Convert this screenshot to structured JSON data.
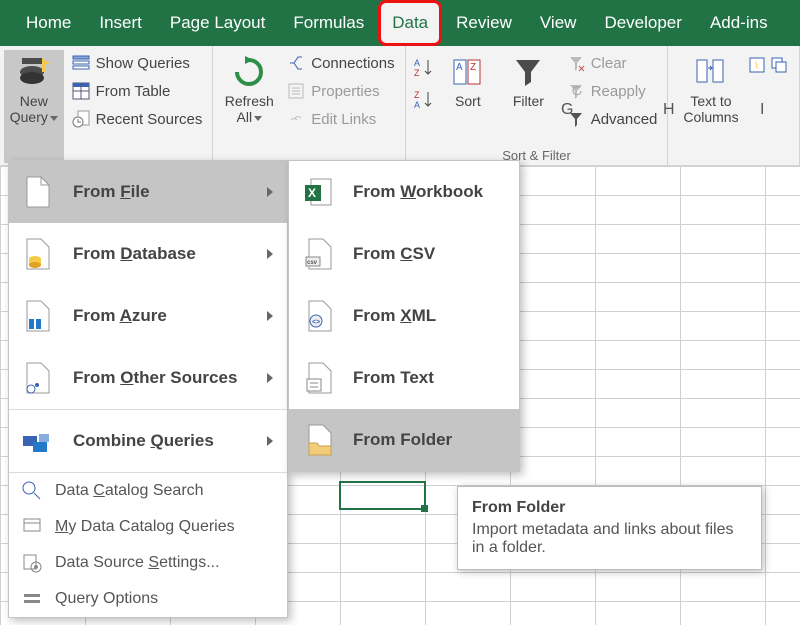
{
  "tabs": [
    "Home",
    "Insert",
    "Page Layout",
    "Formulas",
    "Data",
    "Review",
    "View",
    "Developer",
    "Add-ins"
  ],
  "active_tab_index": 4,
  "ribbon": {
    "newQuery": "New Query",
    "showQueries": "Show Queries",
    "fromTable": "From Table",
    "recentSources": "Recent Sources",
    "refreshAll": "Refresh All",
    "connections": "Connections",
    "properties": "Properties",
    "editLinks": "Edit Links",
    "sort": "Sort",
    "filter": "Filter",
    "clear": "Clear",
    "reapply": "Reapply",
    "advanced": "Advanced",
    "sortFilterCaption": "Sort & Filter",
    "textToColumns1": "Text to",
    "textToColumns2": "Columns"
  },
  "menu1": {
    "fromFile": "From File",
    "fromDatabase": "From Database",
    "fromAzure": "From Azure",
    "fromOther": "From Other Sources",
    "combine": "Combine Queries",
    "catalogSearch": "Data Catalog Search",
    "myCatalog": "My Data Catalog Queries",
    "sourceSettings": "Data Source Settings...",
    "queryOptions": "Query Options"
  },
  "menu2": {
    "fromWorkbook": "From Workbook",
    "fromCSV": "From CSV",
    "fromXML": "From XML",
    "fromText": "From Text",
    "fromFolder": "From Folder"
  },
  "tooltip": {
    "title": "From Folder",
    "body": "Import metadata and links about files in a folder."
  },
  "columns": [
    "G",
    "H",
    "I"
  ]
}
